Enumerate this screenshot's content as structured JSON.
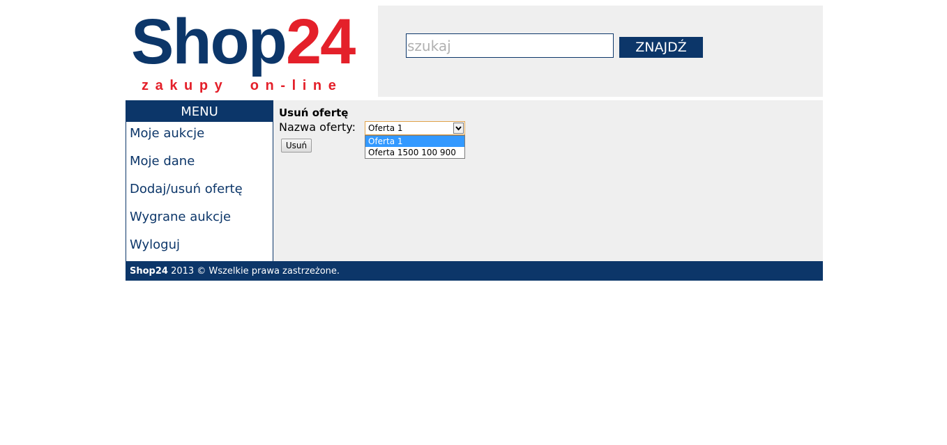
{
  "header": {
    "logo_main": "Shop",
    "logo_number": "24",
    "logo_tagline": "zakupy  on-line",
    "search_placeholder": "szukaj",
    "search_value": "",
    "search_button": "ZNAJDŹ"
  },
  "sidebar": {
    "title": "MENU",
    "items": [
      {
        "label": "Moje aukcje"
      },
      {
        "label": "Moje dane"
      },
      {
        "label": "Dodaj/usuń ofertę"
      },
      {
        "label": "Wygrane aukcje"
      },
      {
        "label": "Wyloguj"
      }
    ]
  },
  "content": {
    "title": "Usuń ofertę",
    "offer_label": "Nazwa oferty:",
    "selected_offer": "Oferta 1",
    "options": [
      {
        "label": "Oferta 1",
        "selected": true
      },
      {
        "label": "Oferta 1500 100 900",
        "selected": false
      }
    ],
    "delete_button": "Usuń"
  },
  "footer": {
    "brand": "Shop24",
    "text": " 2013 © Wszelkie prawa zastrzeżone."
  },
  "colors": {
    "brand_blue": "#0c3669",
    "brand_red": "#e4202a",
    "panel_gray": "#efefef",
    "option_highlight": "#3399ff"
  },
  "icons": {
    "dropdown_arrow": "chevron-down-icon"
  }
}
